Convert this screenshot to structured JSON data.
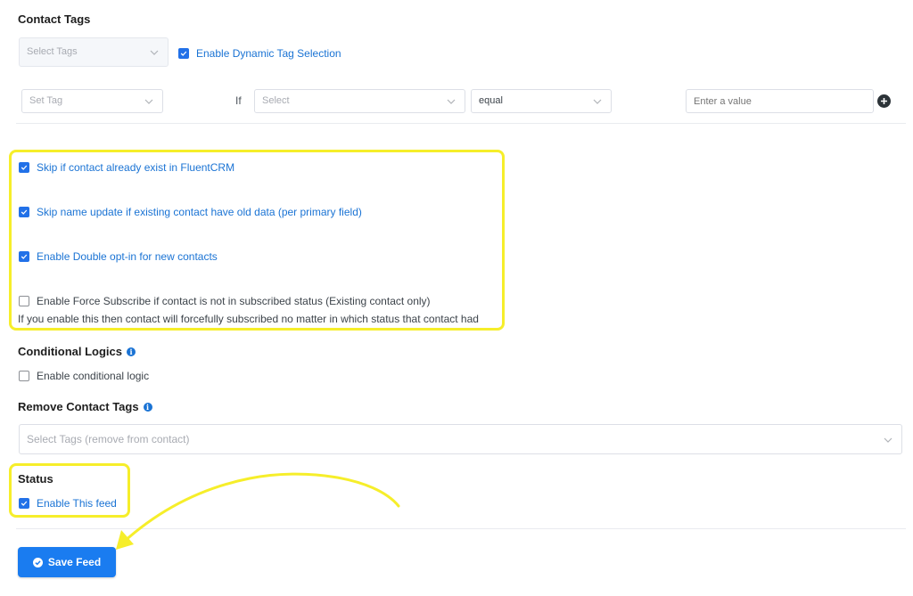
{
  "contact_tags": {
    "title": "Contact Tags",
    "select_tags_placeholder": "Select Tags",
    "dynamic_label": "Enable Dynamic Tag Selection",
    "dynamic_checked": true,
    "rule": {
      "set_tag_placeholder": "Set Tag",
      "if_label": "If",
      "field_placeholder": "Select",
      "operator_value": "equal",
      "value_placeholder": "Enter a value"
    }
  },
  "options": [
    {
      "label": "Skip if contact already exist in FluentCRM",
      "checked": true
    },
    {
      "label": "Skip name update if existing contact have old data (per primary field)",
      "checked": true
    },
    {
      "label": "Enable Double opt-in for new contacts",
      "checked": true
    },
    {
      "label": "Enable Force Subscribe if contact is not in subscribed status (Existing contact only)",
      "checked": false
    }
  ],
  "force_subscribe_help": "If you enable this then contact will forcefully subscribed no matter in which status that contact had",
  "conditional_logics": {
    "title": "Conditional Logics",
    "checkbox_label": "Enable conditional logic",
    "checked": false
  },
  "remove_tags": {
    "title": "Remove Contact Tags",
    "placeholder": "Select Tags (remove from contact)"
  },
  "status": {
    "title": "Status",
    "checkbox_label": "Enable This feed",
    "checked": true
  },
  "save_button_label": "Save Feed",
  "colors": {
    "accent": "#1a7cf0",
    "highlight": "#f6ee2a"
  }
}
